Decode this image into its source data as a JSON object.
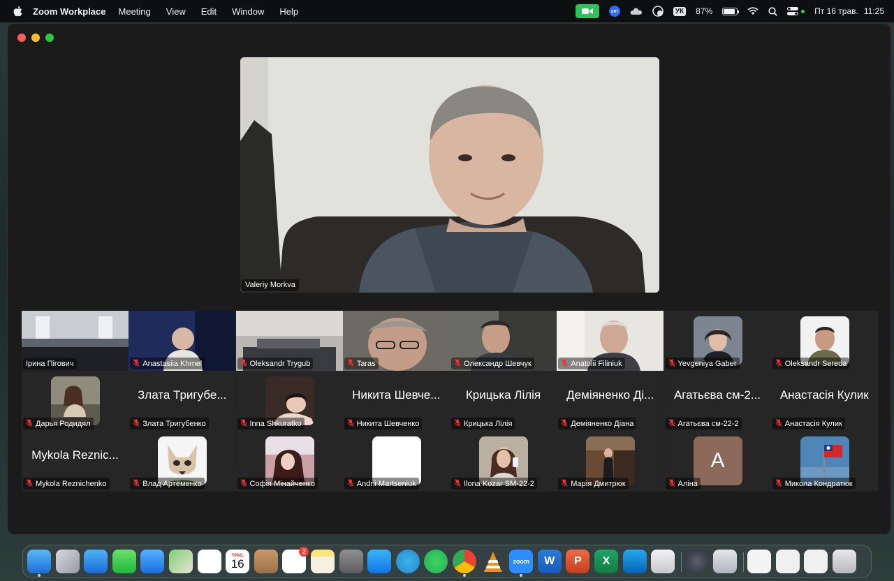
{
  "menubar": {
    "app_name": "Zoom Workplace",
    "menus": [
      "Meeting",
      "View",
      "Edit",
      "Window",
      "Help"
    ],
    "keyboard_layout": "УК",
    "battery_percent": "87%",
    "battery_level": 0.87,
    "date": "Пт 16 трав.",
    "time": "11:25",
    "zoom_badge": "zm",
    "accent_green": "#2fc25b"
  },
  "speaker": {
    "name": "Valeriy Morkva"
  },
  "participants": [
    {
      "name": "Ірина Пігович",
      "type": "video",
      "muted": false
    },
    {
      "name": "Anastasiia Khmel",
      "type": "video",
      "muted": true
    },
    {
      "name": "Oleksandr Trygub",
      "type": "video",
      "muted": true
    },
    {
      "name": "Taras",
      "type": "video",
      "muted": true
    },
    {
      "name": "Олександр Шевчук",
      "type": "video",
      "muted": true
    },
    {
      "name": "Anatolii Filiniuk",
      "type": "video",
      "muted": true
    },
    {
      "name": "Yevgeniya Gaber",
      "type": "avatar",
      "muted": true
    },
    {
      "name": "Oleksandr Sereda",
      "type": "avatar",
      "muted": true
    },
    {
      "name": "Дарья Родидял",
      "type": "avatar",
      "muted": true
    },
    {
      "name": "Злата Тригубенко",
      "display": "Злата Тригубе...",
      "type": "text",
      "muted": true
    },
    {
      "name": "Inna Shkuratko",
      "type": "avatar",
      "muted": true
    },
    {
      "name": "Никита Шевченко",
      "display": "Никита Шевче...",
      "type": "text",
      "muted": true
    },
    {
      "name": "Крицька Лілія",
      "display": "Крицька Лілія",
      "type": "text",
      "muted": true
    },
    {
      "name": "Деміяненко Діана",
      "display": "Деміяненко Ді...",
      "type": "text",
      "muted": true
    },
    {
      "name": "Агатьєва см-22-2",
      "display": "Агатьєва см-2...",
      "type": "text",
      "muted": true
    },
    {
      "name": "Анастасія Кулик",
      "display": "Анастасія Кулик",
      "type": "text",
      "muted": true
    },
    {
      "name": "Mykola Reznichenko",
      "display": "Mykola Reznic...",
      "type": "text",
      "muted": true
    },
    {
      "name": "Влад Артёменко",
      "type": "avatar",
      "muted": true
    },
    {
      "name": "Софія Мінайченко",
      "type": "avatar",
      "muted": true
    },
    {
      "name": "Andrii Martseniuk",
      "type": "avatar",
      "muted": true
    },
    {
      "name": "Ilona Kozar SM-22-2",
      "type": "avatar",
      "muted": true
    },
    {
      "name": "Марія Дмитрюк",
      "type": "avatar",
      "muted": true
    },
    {
      "name": "Аліна",
      "type": "letter",
      "letter": "A",
      "muted": true
    },
    {
      "name": "Микола Кондратюк",
      "type": "avatar",
      "muted": true
    }
  ],
  "dock": {
    "calendar_month": "ТРАВ.",
    "calendar_day": "16",
    "reminders_badge": "2",
    "zoom_label": "zoom",
    "apps": [
      "Finder",
      "Launchpad",
      "Safari",
      "Messages",
      "Mail",
      "Maps",
      "Photos",
      "Calendar",
      "Contacts",
      "Reminders",
      "Notes",
      "System Settings",
      "App Store",
      "Telegram",
      "WhatsApp",
      "Chrome",
      "VLC",
      "Zoom",
      "Word",
      "PowerPoint",
      "Excel",
      "OneDrive",
      "iPhone Mirroring",
      "QuickTime",
      "Preview",
      "Documents",
      "Screenshot",
      "Screenshot",
      "Trash"
    ]
  }
}
